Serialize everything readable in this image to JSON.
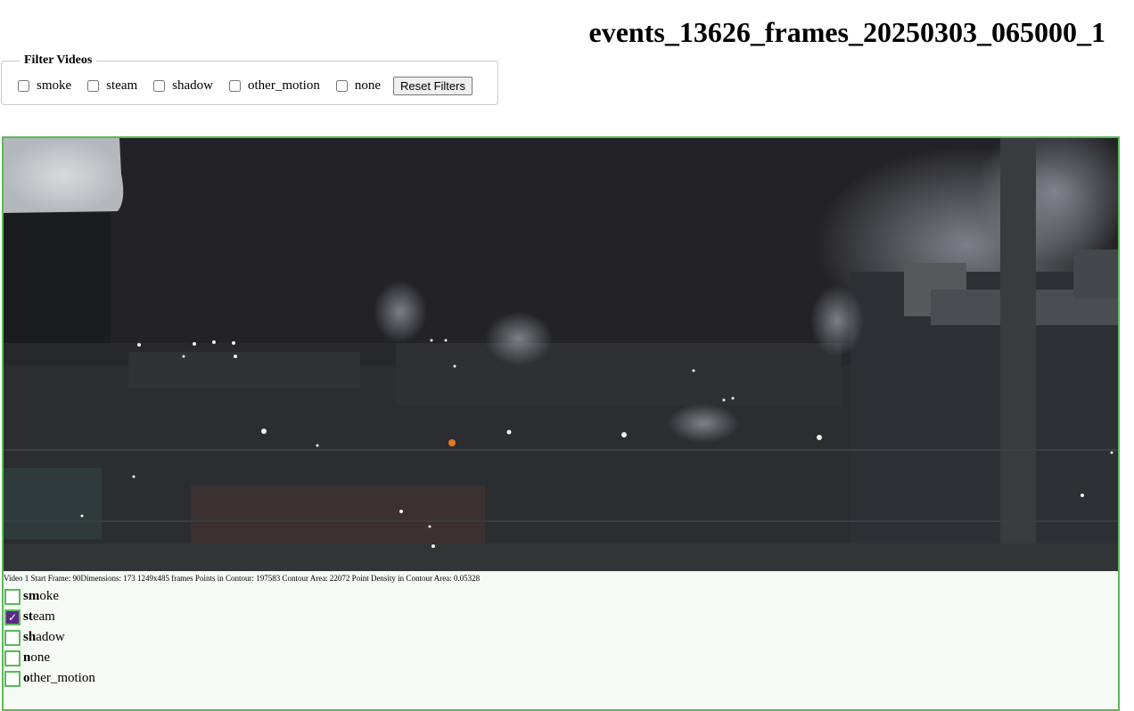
{
  "page": {
    "title": "events_13626_frames_20250303_065000_1"
  },
  "filters": {
    "legend": "Filter Videos",
    "options": [
      {
        "label": "smoke",
        "checked": false
      },
      {
        "label": "steam",
        "checked": false
      },
      {
        "label": "shadow",
        "checked": false
      },
      {
        "label": "other_motion",
        "checked": false
      },
      {
        "label": "none",
        "checked": false
      }
    ],
    "reset_label": "Reset Filters"
  },
  "video": {
    "info": "Video 1 Start Frame: 90Dimensions: 173 1249x485 frames Points in Contour: 197583 Contour Area: 22072 Point Density in Contour Area: 0.05328",
    "border_color": "#5cb85c",
    "labels": [
      {
        "key": "sm",
        "rest": "oke",
        "checked": false
      },
      {
        "key": "st",
        "rest": "eam",
        "checked": true
      },
      {
        "key": "sh",
        "rest": "adow",
        "checked": false
      },
      {
        "key": "n",
        "rest": "one",
        "checked": false
      },
      {
        "key": "o",
        "rest": "ther_motion",
        "checked": false
      }
    ]
  },
  "colors": {
    "accent_green": "#5cb85c",
    "checked_purple": "#5b2a86",
    "card_background": "#f5faf4"
  }
}
